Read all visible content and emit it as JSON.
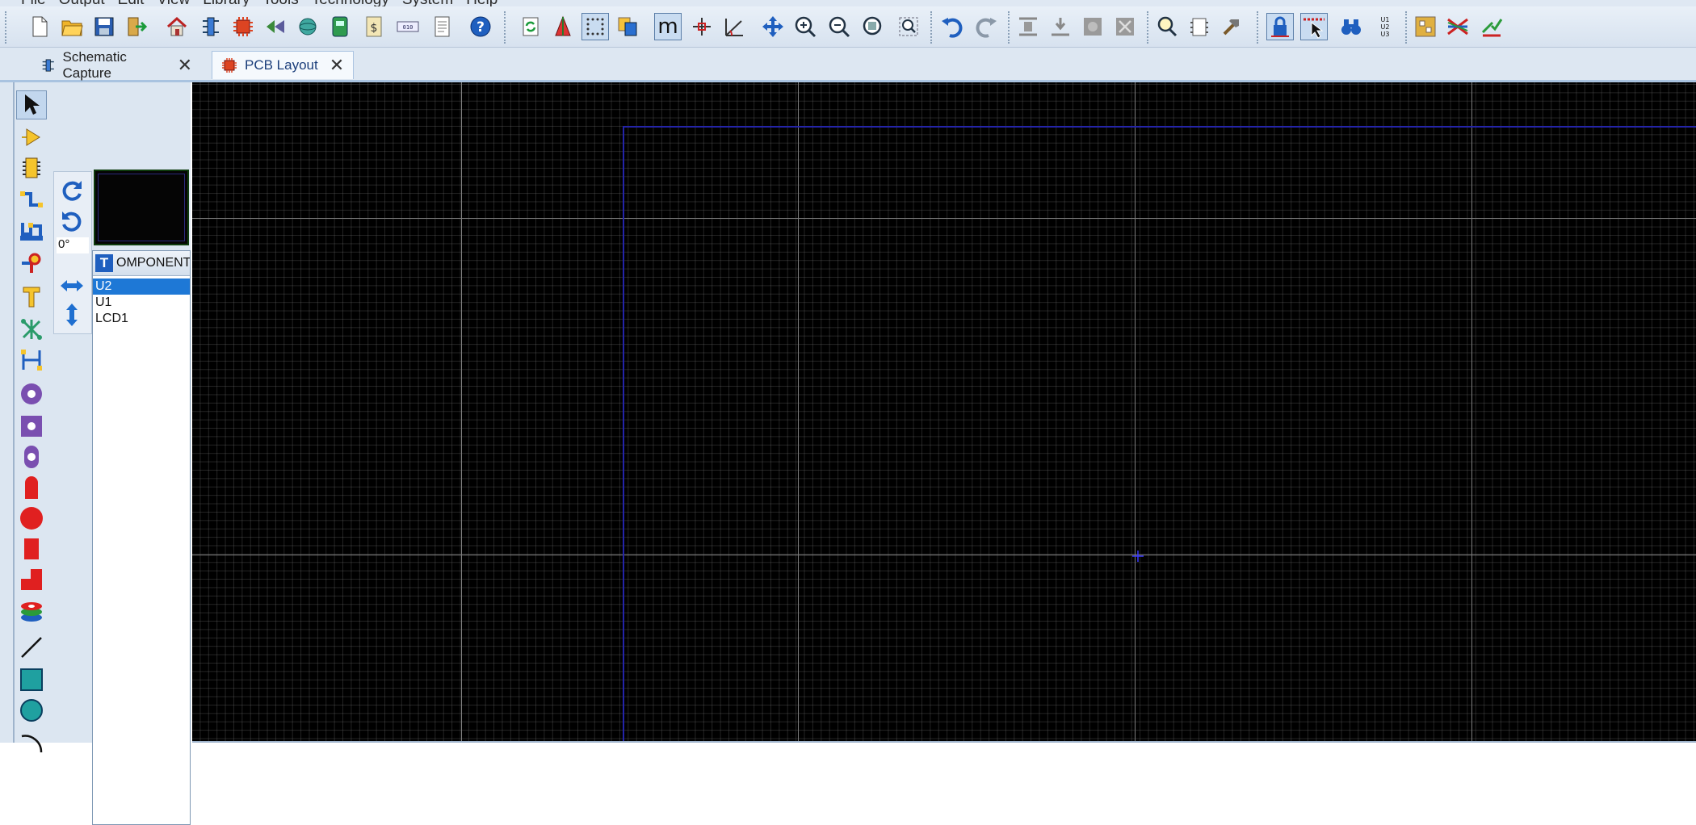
{
  "menu": {
    "items": [
      "File",
      "Output",
      "Edit",
      "View",
      "Library",
      "Tools",
      "Technology",
      "System",
      "Help"
    ]
  },
  "toolbar": {
    "buttons": [
      {
        "name": "new-icon"
      },
      {
        "name": "open-folder-icon"
      },
      {
        "name": "save-icon"
      },
      {
        "name": "import-icon"
      },
      {
        "name": "home-icon"
      },
      {
        "name": "schematic-capture-icon"
      },
      {
        "name": "pcb-layout-icon"
      },
      {
        "name": "simulation-graph-icon"
      },
      {
        "name": "3d-viewer-icon"
      },
      {
        "name": "gerber-viewer-icon"
      },
      {
        "name": "bill-of-materials-icon"
      },
      {
        "name": "source-code-icon"
      },
      {
        "name": "design-notes-icon"
      },
      {
        "name": "help-icon"
      },
      {
        "name": "refresh-icon"
      },
      {
        "name": "layers-toggle-icon"
      },
      {
        "name": "grid-toggle-icon"
      },
      {
        "name": "copy-layers-icon"
      },
      {
        "name": "metric-toggle-icon"
      },
      {
        "name": "false-origin-icon"
      },
      {
        "name": "polar-icon"
      },
      {
        "name": "pan-icon"
      },
      {
        "name": "zoom-in-icon"
      },
      {
        "name": "zoom-out-icon"
      },
      {
        "name": "zoom-all-icon"
      },
      {
        "name": "zoom-area-icon"
      },
      {
        "name": "undo-icon"
      },
      {
        "name": "redo-icon"
      },
      {
        "name": "block-copy-icon"
      },
      {
        "name": "block-move-icon"
      },
      {
        "name": "block-rotate-icon"
      },
      {
        "name": "block-delete-icon"
      },
      {
        "name": "pick-parts-icon"
      },
      {
        "name": "make-package-icon"
      },
      {
        "name": "decompose-icon"
      },
      {
        "name": "design-rule-lock-icon"
      },
      {
        "name": "tagging-cursor-icon"
      },
      {
        "name": "search-binoculars-icon"
      },
      {
        "name": "annotate-icon"
      },
      {
        "name": "autoplacer-icon"
      },
      {
        "name": "autorouter-icon"
      },
      {
        "name": "design-rule-check-icon"
      }
    ],
    "annotate_text": [
      "U1",
      "U2",
      "U3"
    ],
    "metric_text": "m"
  },
  "tabs": [
    {
      "label": "Schematic Capture",
      "selected": false
    },
    {
      "label": "PCB Layout",
      "selected": true
    }
  ],
  "mode_tools": [
    "selection-mode-icon",
    "component-mode-icon",
    "package-mode-icon",
    "track-mode-icon",
    "via-mode-icon",
    "zone-mode-icon",
    "ratsnest-mode-icon",
    "connectivity-highlight-icon",
    "dimension-mode-icon",
    "round-pad-icon",
    "square-pad-icon",
    "dil-pad-icon",
    "edge-connector-pad-icon",
    "circular-smt-pad-icon",
    "rectangular-smt-pad-icon",
    "polygonal-smt-pad-icon",
    "padstack-icon",
    "line-mode-icon",
    "box-mode-icon",
    "circle-mode-icon",
    "arc-mode-icon"
  ],
  "orientation": {
    "rotate_cw": "rotate-clockwise-icon",
    "rotate_ccw": "rotate-anticlockwise-icon",
    "angle": "0°",
    "mirror_x": "mirror-horizontal-icon",
    "mirror_y": "mirror-vertical-icon"
  },
  "selector": {
    "toggle_label": "T",
    "title": "OMPONENT",
    "items": [
      {
        "label": "U2",
        "selected": true
      },
      {
        "label": "U1",
        "selected": false
      },
      {
        "label": "LCD1",
        "selected": false
      }
    ]
  },
  "colors": {
    "canvas_background": "#000000",
    "grid_minor": "#3a3a3a",
    "grid_major": "#7d7d7d",
    "board_edge": "#2424a8",
    "selection_highlight": "#1e78d6",
    "pad_red": "#e02020",
    "pad_purple": "#7a4fb0"
  }
}
